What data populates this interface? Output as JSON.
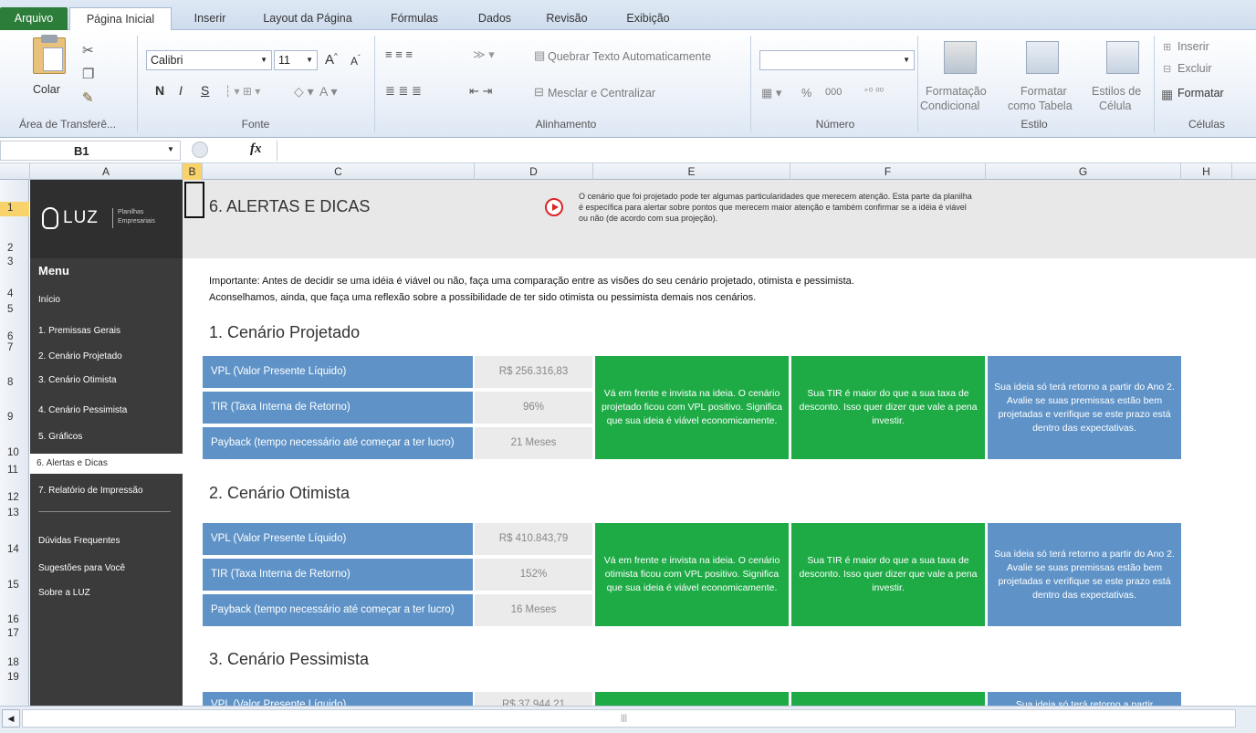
{
  "ribbon_tabs": [
    "Arquivo",
    "Página Inicial",
    "Inserir",
    "Layout da Página",
    "Fórmulas",
    "Dados",
    "Revisão",
    "Exibição"
  ],
  "clipboard": {
    "paste": "Colar",
    "group": "Área de Transferê..."
  },
  "font": {
    "name": "Calibri",
    "size": "11",
    "bold": "N",
    "italic": "I",
    "underline": "S",
    "group": "Fonte"
  },
  "alignment": {
    "wrap": "Quebrar Texto Automaticamente",
    "merge": "Mesclar e Centralizar",
    "group": "Alinhamento"
  },
  "number": {
    "percent": "%",
    "thousands": "000",
    "group": "Número"
  },
  "styles": {
    "conditional_1": "Formatação",
    "conditional_2": "Condicional",
    "table_1": "Formatar",
    "table_2": "como Tabela",
    "cell_1": "Estilos de",
    "cell_2": "Célula",
    "group": "Estilo"
  },
  "cells": {
    "insert": "Inserir",
    "delete": "Excluir",
    "format": "Formatar",
    "group": "Células"
  },
  "formula_bar": {
    "name_box": "B1",
    "fx": "fx",
    "content": ""
  },
  "columns": [
    "A",
    "B",
    "C",
    "D",
    "E",
    "F",
    "G",
    "H"
  ],
  "rows": [
    "1",
    "2",
    "3",
    "4",
    "5",
    "6",
    "7",
    "8",
    "9",
    "10",
    "11",
    "12",
    "13",
    "14",
    "15",
    "16",
    "17",
    "18",
    "19"
  ],
  "logo": {
    "name": "LUZ",
    "tag1": "Planilhas",
    "tag2": "Empresariais"
  },
  "menu": {
    "title": "Menu",
    "items": [
      "Início",
      "1. Premissas  Gerais",
      "2. Cenário  Projetado",
      "3. Cenário  Otimista",
      "4. Cenário  Pessimista",
      "5. Gráficos",
      "6. Alertas  e Dicas",
      "7. Relatório  de Impressão"
    ],
    "extra": [
      "Dúvidas Frequentes",
      "Sugestões para Você",
      "Sobre a LUZ"
    ]
  },
  "page": {
    "title": "6. ALERTAS E DICAS",
    "note1": "O cenário que foi projetado pode ter algumas particularidades que merecem atenção. Esta parte da planilha",
    "note2": "é específica para alertar sobre pontos que merecem maior atenção e também confirmar se a idéia é viável",
    "note3": "ou não (de acordo com sua projeção).",
    "intro1": "Importante: Antes de decidir se uma idéia é viável ou não, faça uma comparação entre as visões do seu cenário projetado, otimista e pessimista.",
    "intro2": "Aconselhamos, ainda, que faça uma reflexão sobre a possibilidade de ter sido otimista ou pessimista demais nos cenários."
  },
  "labels": {
    "vpl": "VPL (Valor Presente Líquido)",
    "tir": "TIR (Taxa Interna de Retorno)",
    "payback": "Payback (tempo necessário até começar a ter lucro)",
    "vpl_cut": "VPL (Valor Presente Líquido)"
  },
  "scenarios": [
    {
      "title": "1. Cenário Projetado",
      "vpl": "R$ 256.316,83",
      "tir": "96%",
      "payback": "21 Meses",
      "msg_vpl": "Vá em frente e invista na ideia. O cenário projetado ficou com VPL positivo. Significa que sua ideia é viável economicamente.",
      "msg_tir": "Sua TIR é maior do que a sua taxa de desconto. Isso quer dizer que vale a pena investir.",
      "msg_payback": "Sua ideia só terá retorno a partir do Ano 2. Avalie se suas premissas estão bem projetadas e verifique se este prazo está dentro das expectativas."
    },
    {
      "title": "2. Cenário Otimista",
      "vpl": "R$ 410.843,79",
      "tir": "152%",
      "payback": "16 Meses",
      "msg_vpl": "Vá em frente e invista na ideia. O cenário otimista ficou com VPL positivo. Significa que sua ideia é viável economicamente.",
      "msg_tir": "Sua TIR é maior do que a sua taxa de desconto. Isso quer dizer que vale a pena investir.",
      "msg_payback": "Sua ideia só terá retorno a partir do Ano 2. Avalie se suas premissas estão bem projetadas e verifique se este prazo está dentro das expectativas."
    },
    {
      "title": "3. Cenário Pessimista",
      "vpl": "R$ 37.944,21",
      "msg_payback": "Sua ideia só terá retorno a partir"
    }
  ],
  "colors": {
    "green": "#1eab46",
    "blue": "#5f93c8",
    "sidebar": "#3b3b3b",
    "file_tab": "#2d7d3a"
  }
}
